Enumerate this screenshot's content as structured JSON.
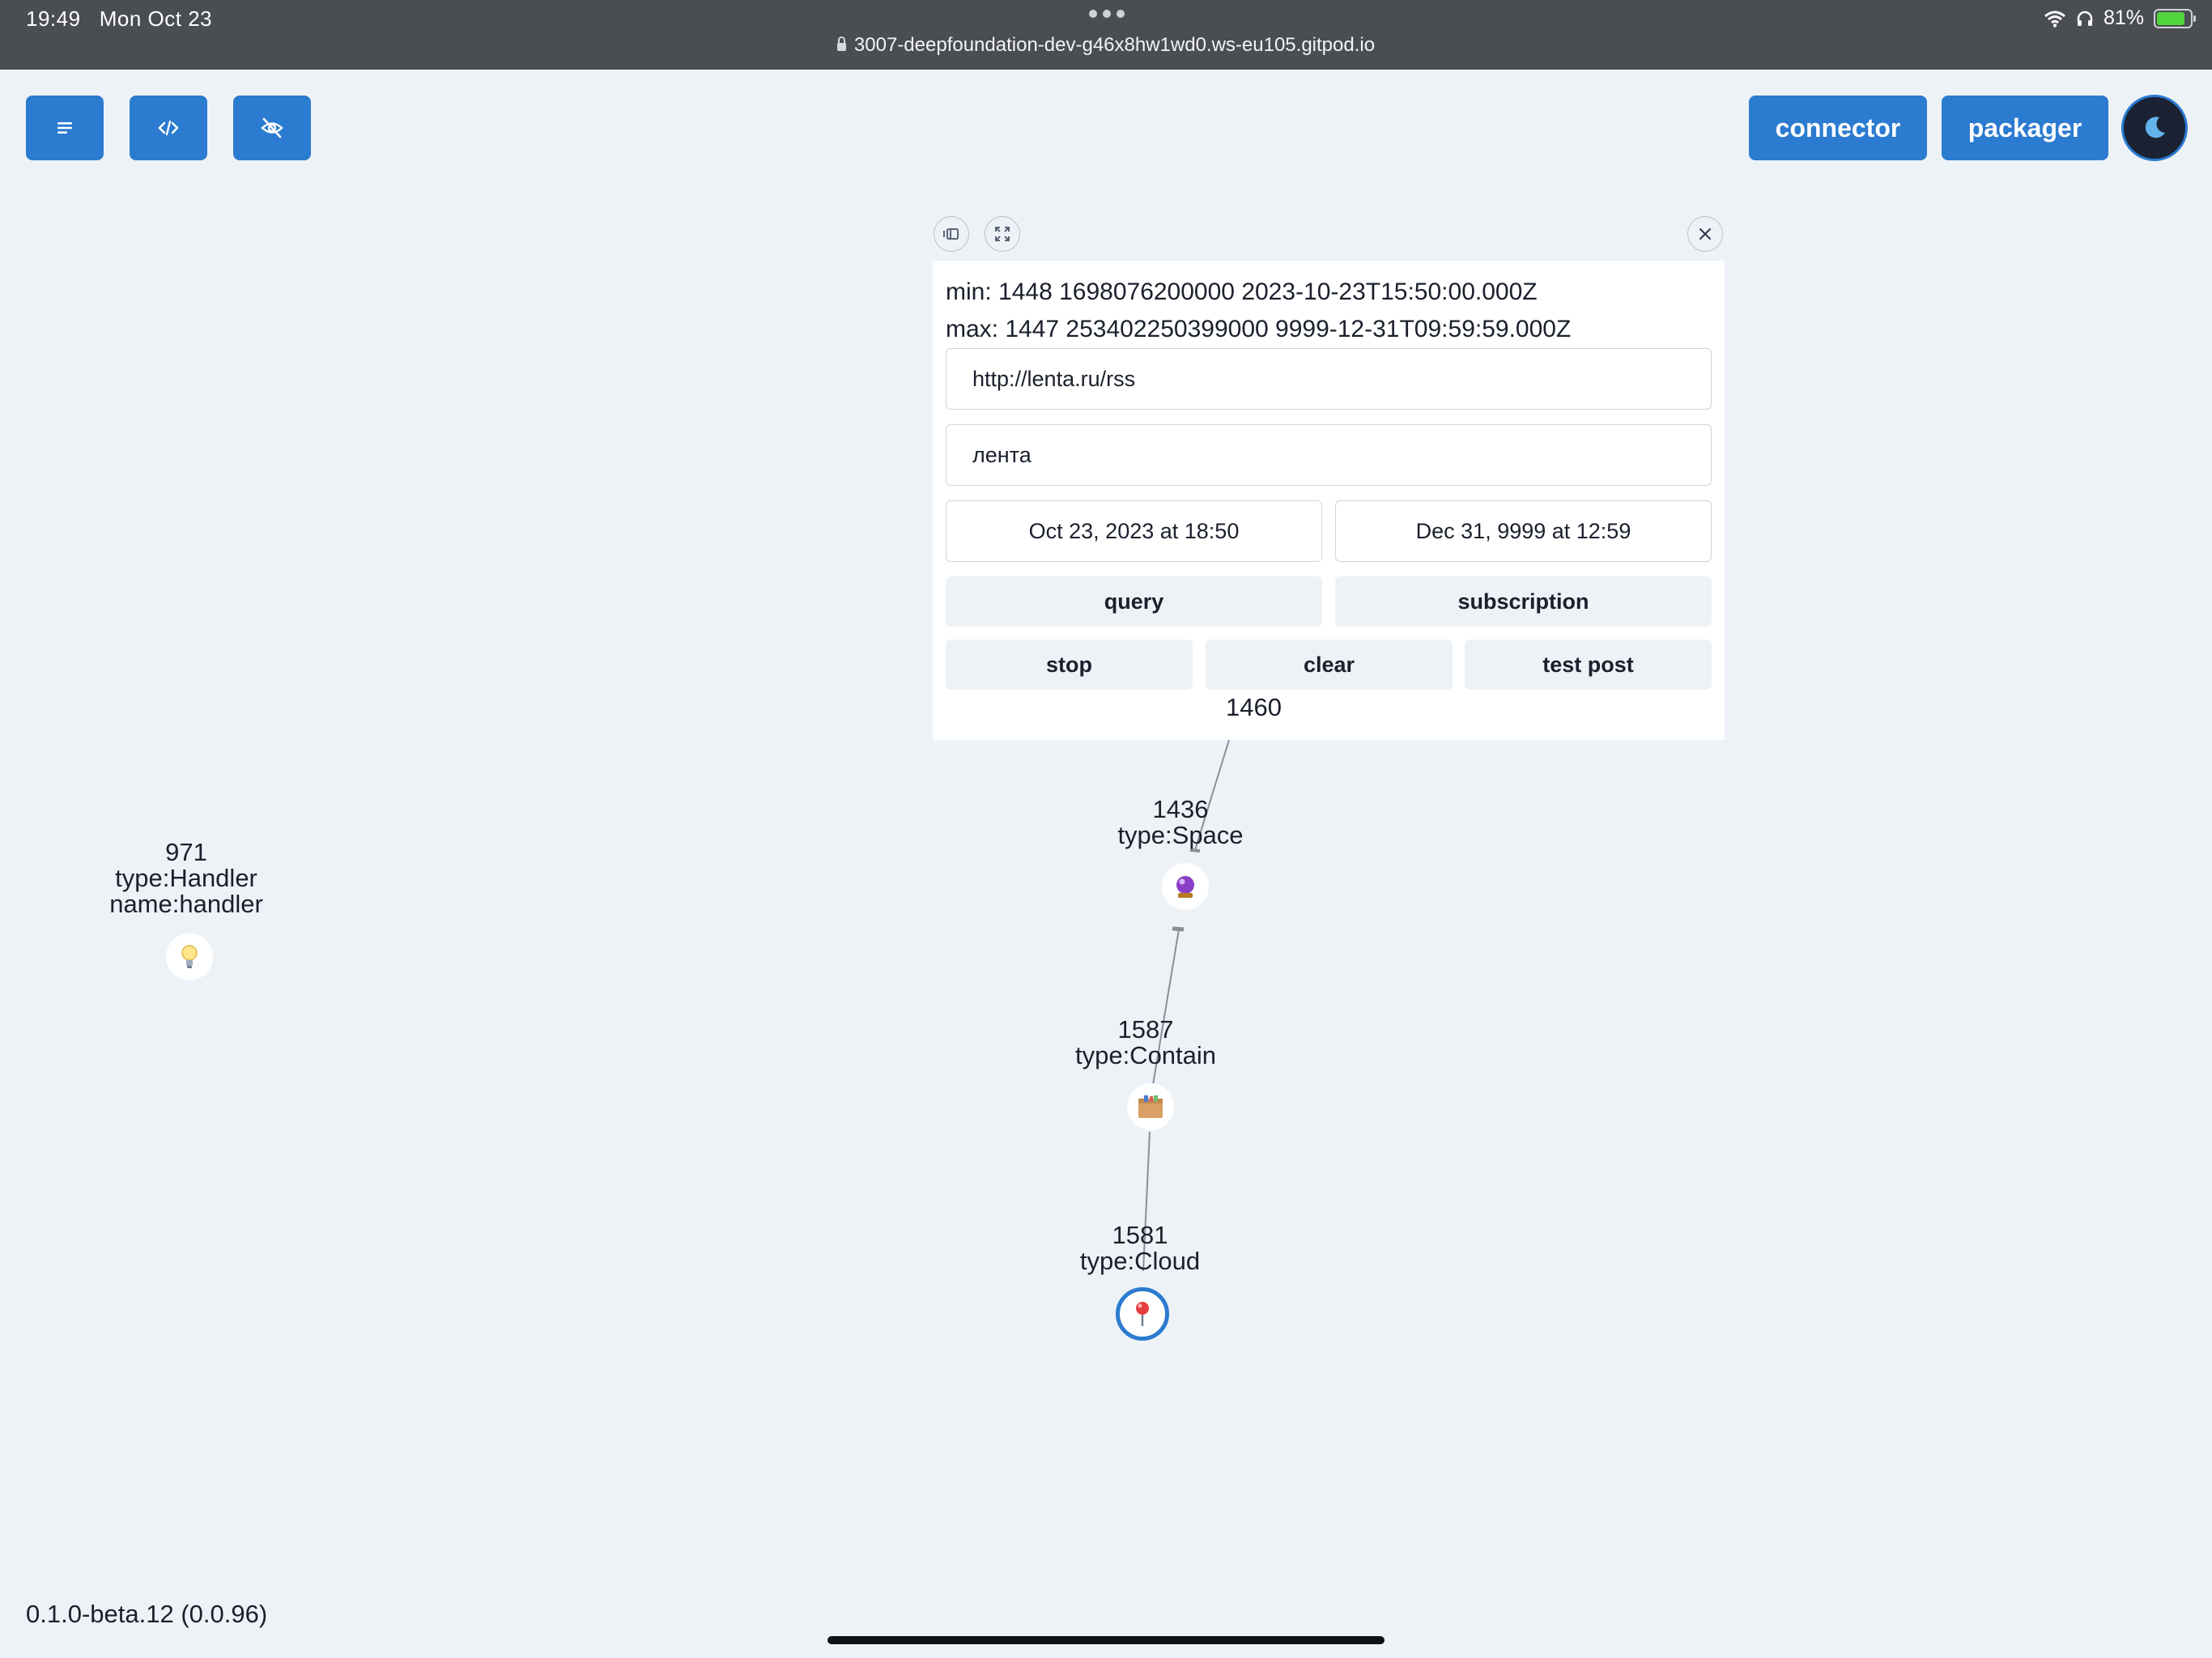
{
  "status_bar": {
    "time": "19:49",
    "date": "Mon Oct 23",
    "url": "3007-deepfoundation-dev-g46x8hw1wd0.ws-eu105.gitpod.io",
    "battery": "81%"
  },
  "toolbar": {
    "connector_label": "connector",
    "packager_label": "packager"
  },
  "panel": {
    "min_line": "min: 1448 1698076200000 2023-10-23T15:50:00.000Z",
    "max_line": "max: 1447 253402250399000 9999-12-31T09:59:59.000Z",
    "url_value": "http://lenta.ru/rss",
    "name_value": "лента",
    "date_from": "Oct 23, 2023 at 18:50",
    "date_to": "Dec 31, 9999 at 12:59",
    "query_label": "query",
    "subscription_label": "subscription",
    "stop_label": "stop",
    "clear_label": "clear",
    "test_post_label": "test post",
    "count": "1460"
  },
  "graph": {
    "nodes": [
      {
        "id": "971",
        "type": "type:Handler",
        "name": "name:handler",
        "icon": "lightbulb-icon"
      },
      {
        "id": "1436",
        "type": "type:Space",
        "icon": "crystal-ball-icon"
      },
      {
        "id": "1587",
        "type": "type:Contain",
        "icon": "package-box-icon"
      },
      {
        "id": "1581",
        "type": "type:Cloud",
        "icon": "map-pin-icon"
      }
    ]
  },
  "version": "0.1.0-beta.12 (0.0.96)"
}
